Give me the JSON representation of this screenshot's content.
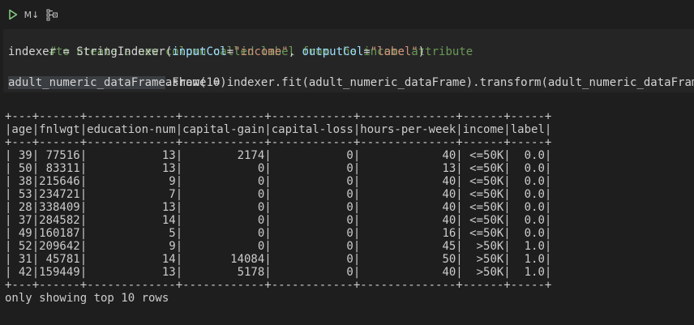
{
  "toolbar": {
    "run_icon": "play-icon",
    "markdown_label": "M↓",
    "variables_icon": "variable-explorer-icon"
  },
  "code": {
    "comment": "#to create a new column called label from the income attribute",
    "line2_prefix": "indexer = StringIndexer(",
    "line2_param1": "inputCol",
    "line2_eq1": "=",
    "line2_str1": "\"income\"",
    "line2_sep": ", ",
    "line2_param2": "outputCol",
    "line2_eq2": "=",
    "line2_str2": "\"label\"",
    "line2_suffix": ")",
    "line3": "adult_numeric_dataFrame = indexer.fit(adult_numeric_dataFrame).transform(adult_numeric_dataFrame)",
    "line4_highlight": "adult_numeric_dataFrame",
    "line4_rest": ".show(10)"
  },
  "table": {
    "separator": "+---+------+-------------+------------+------------+--------------+------+-----+",
    "header": "|age|fnlwgt|education-num|capital-gain|capital-loss|hours-per-week|income|label|",
    "rows": [
      "| 39| 77516|           13|        2174|           0|            40| <=50K|  0.0|",
      "| 50| 83311|           13|           0|           0|            13| <=50K|  0.0|",
      "| 38|215646|            9|           0|           0|            40| <=50K|  0.0|",
      "| 53|234721|            7|           0|           0|            40| <=50K|  0.0|",
      "| 28|338409|           13|           0|           0|            40| <=50K|  0.0|",
      "| 37|284582|           14|           0|           0|            40| <=50K|  0.0|",
      "| 49|160187|            5|           0|           0|            16| <=50K|  0.0|",
      "| 52|209642|            9|           0|           0|            45|  >50K|  1.0|",
      "| 31| 45781|           14|       14084|           0|            50|  >50K|  1.0|",
      "| 42|159449|           13|        5178|           0|            40|  >50K|  1.0|"
    ]
  },
  "footer": "only showing top 10 rows",
  "colors": {
    "background": "#1e1e1e",
    "editor_background": "#252526",
    "comment": "#6a9955",
    "parameter": "#9cdcfe",
    "string": "#ce9178",
    "run_icon": "#89d185"
  }
}
